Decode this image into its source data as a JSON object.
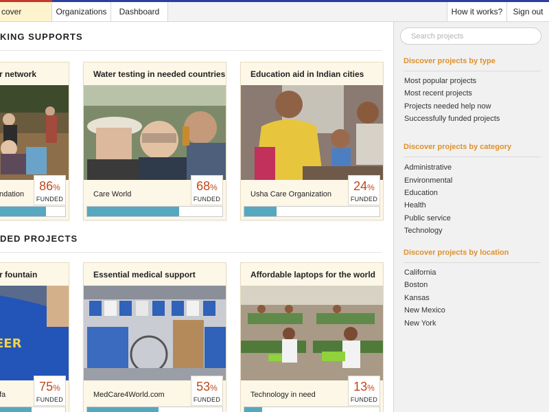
{
  "nav": {
    "items": [
      {
        "label": "cover projects",
        "active": true
      },
      {
        "label": "Organizations",
        "active": false
      },
      {
        "label": "Dashboard",
        "active": false
      }
    ],
    "right_items": [
      "How it works?",
      "Sign out"
    ]
  },
  "sections": [
    {
      "title": "KING SUPPORTS",
      "cards": [
        {
          "title": "r network",
          "org": "ndation",
          "percent": 86,
          "image_icon": "volunteers-planting-photo"
        },
        {
          "title": "Water testing in needed countries",
          "org": "Care World",
          "percent": 68,
          "image_icon": "water-testing-photo"
        },
        {
          "title": "Education aid in Indian cities",
          "org": "Usha Care Organization",
          "percent": 24,
          "image_icon": "classroom-children-photo"
        }
      ]
    },
    {
      "title": "DED PROJECTS",
      "cards": [
        {
          "title": "r fountain",
          "org": "fa",
          "percent": 75,
          "image_icon": "volunteer-shirt-photo"
        },
        {
          "title": "Essential medical support",
          "org": "MedCare4World.com",
          "percent": 53,
          "image_icon": "medical-supplies-photo"
        },
        {
          "title": "Affordable laptops for the world",
          "org": "Technology in need",
          "percent": 13,
          "image_icon": "students-laptops-photo"
        }
      ]
    }
  ],
  "funded_label": "FUNDED",
  "percent_sign": "%",
  "sidebar": {
    "search_placeholder": "Search projects",
    "groups": [
      {
        "heading": "Discover projects by type",
        "links": [
          "Most popular projects",
          "Most recent projects",
          "Projects needed help now",
          "Successfully funded projects"
        ]
      },
      {
        "heading": "Discover projects by category",
        "links": [
          "Administrative",
          "Environmental",
          "Education",
          "Health",
          "Public service",
          "Technology"
        ]
      },
      {
        "heading": "Discover projects by location",
        "links": [
          "California",
          "Boston",
          "Kansas",
          "New Mexico",
          "New York"
        ]
      }
    ]
  },
  "colors": {
    "accent_orange": "#e0902a",
    "percent_red": "#c0471b",
    "progress_blue": "#56a7c0",
    "card_bg": "#fdf7e8",
    "nav_active_bg": "#fdf3cf"
  }
}
